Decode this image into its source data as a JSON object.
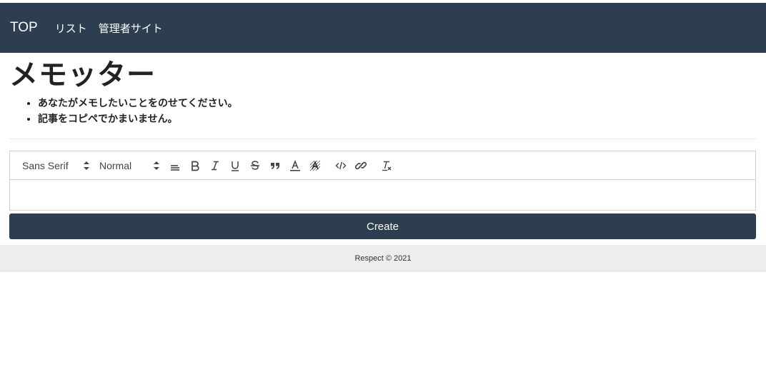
{
  "navbar": {
    "brand": "TOP",
    "links": [
      "リスト",
      "管理者サイト"
    ],
    "background": "#2c3e50"
  },
  "main": {
    "title": "メモッター",
    "notes": [
      "あなたがメモしたいことをのせてください。",
      "記事をコピペでかまいません。"
    ]
  },
  "editor": {
    "font_picker": "Sans Serif",
    "size_picker": "Normal",
    "toolbar_icons": [
      "align-icon",
      "bold-icon",
      "italic-icon",
      "underline-icon",
      "strike-icon",
      "blockquote-icon",
      "text-color-icon",
      "background-color-icon",
      "code-icon",
      "link-icon",
      "clear-format-icon"
    ],
    "content": ""
  },
  "actions": {
    "create_label": "Create"
  },
  "footer": {
    "text": "Respect © 2021"
  }
}
